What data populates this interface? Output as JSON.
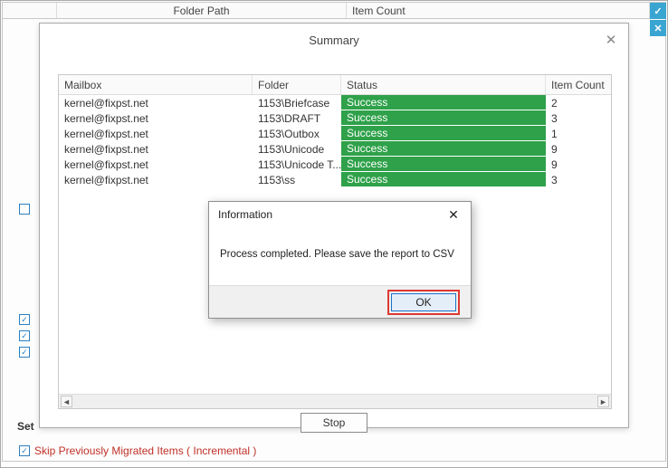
{
  "background": {
    "header": {
      "folder_path": "Folder Path",
      "item_count": "Item Count"
    },
    "set_filter_label": "Set",
    "skip_prev": "Skip Previously Migrated Items ( Incremental )"
  },
  "summary": {
    "title": "Summary",
    "columns": {
      "mailbox": "Mailbox",
      "folder": "Folder",
      "status": "Status",
      "item_count": "Item Count"
    },
    "rows": [
      {
        "mailbox": "kernel@fixpst.net",
        "folder": "1153\\Briefcase",
        "status": "Success",
        "count": "2"
      },
      {
        "mailbox": "kernel@fixpst.net",
        "folder": "1153\\DRAFT",
        "status": "Success",
        "count": "3"
      },
      {
        "mailbox": "kernel@fixpst.net",
        "folder": "1153\\Outbox",
        "status": "Success",
        "count": "1"
      },
      {
        "mailbox": "kernel@fixpst.net",
        "folder": "1153\\Unicode",
        "status": "Success",
        "count": "9"
      },
      {
        "mailbox": "kernel@fixpst.net",
        "folder": "1153\\Unicode T...",
        "status": "Success",
        "count": "9"
      },
      {
        "mailbox": "kernel@fixpst.net",
        "folder": "1153\\ss",
        "status": "Success",
        "count": "3"
      }
    ],
    "stop_label": "Stop"
  },
  "dialog": {
    "title": "Information",
    "message": "Process completed. Please save the report to CSV",
    "ok_label": "OK"
  },
  "colors": {
    "success_bg": "#2fa14a",
    "highlight_border": "#dd3a33",
    "ok_border": "#1a72c8"
  }
}
